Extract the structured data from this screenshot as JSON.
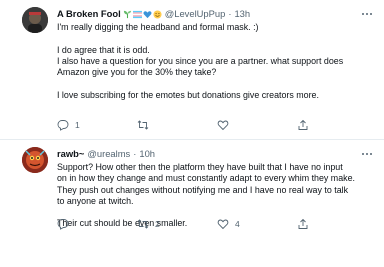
{
  "tweets": [
    {
      "author": {
        "name": "A Broken Fool",
        "handle": "@LevelUpPup",
        "emojis": [
          "seedling-icon",
          "trans-flag-icon",
          "blue-heart-icon",
          "smiling-face-icon"
        ]
      },
      "time": "13h",
      "text": {
        "line1": "I'm really digging the headband and formal mask. :)",
        "line2": "I do agree that it is odd.",
        "line3": "I also have a question for you since you are a partner. what support does",
        "line4": "Amazon give you for the 30% they take?",
        "line5": "I love subscribing for the emotes but donations give creators more."
      },
      "actions": {
        "reply": "1",
        "retweet": "",
        "like": ""
      }
    },
    {
      "author": {
        "name": "rawb~",
        "handle": "@urealms",
        "emojis": []
      },
      "time": "10h",
      "text": {
        "line1": "Support? How other then the platform they have built that I have no input",
        "line2": "on in how they change and must constantly adapt to every whim they make.",
        "line3": "They push out changes without notifying me and I have no real way to talk",
        "line4": "to anyone at twitch.",
        "line5": "Their cut should be even smaller."
      },
      "actions": {
        "reply": "",
        "retweet": "2",
        "like": "4"
      }
    }
  ],
  "colors": {
    "text": "#0f1419",
    "secondary": "#536471",
    "divider": "#e6ecf0"
  }
}
